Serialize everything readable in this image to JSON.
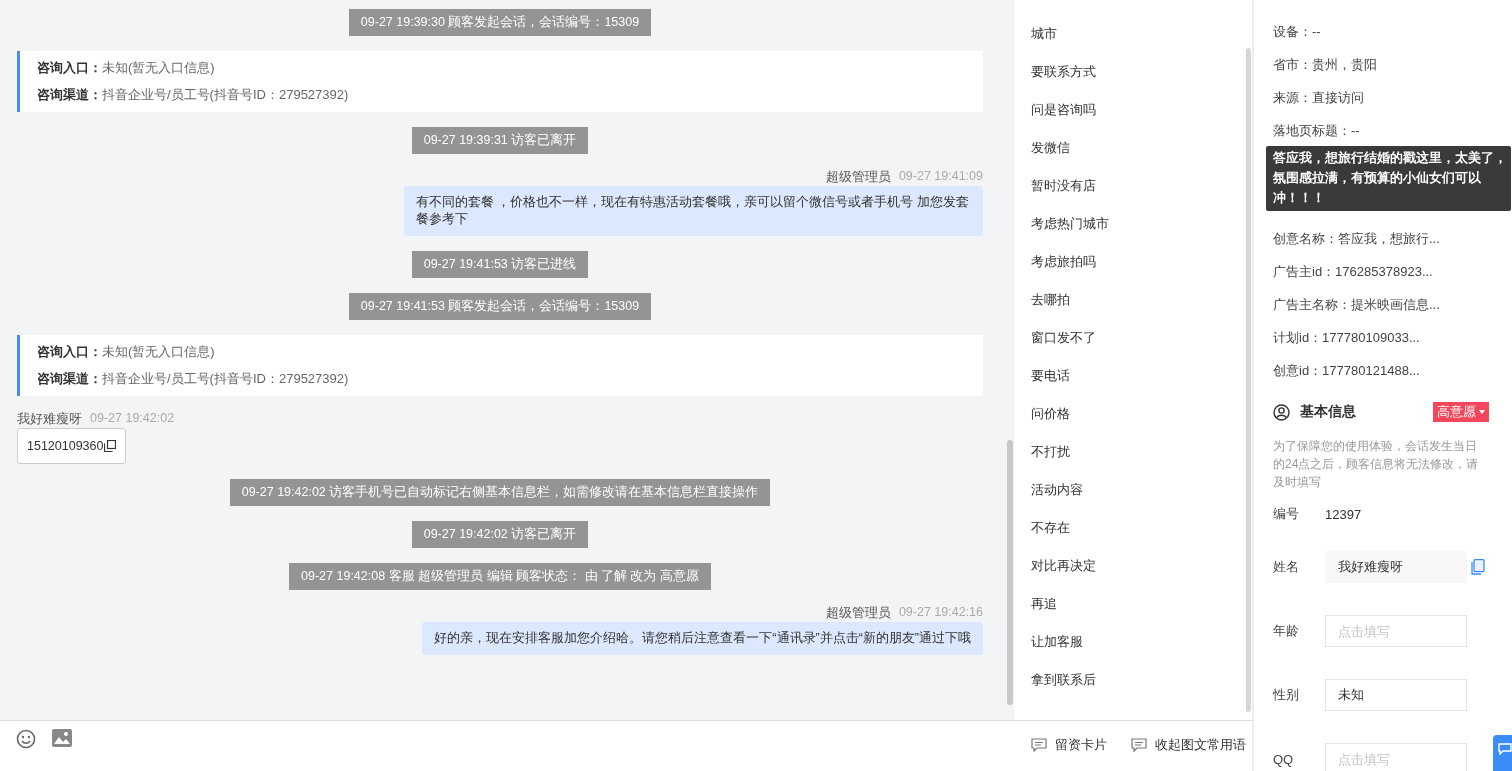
{
  "chat": {
    "messages": [
      {
        "kind": "system",
        "text": "09-27 19:39:30 顾客发起会话，会话编号：15309"
      },
      {
        "kind": "entry",
        "lines": [
          {
            "label": "咨询入口：",
            "value": "未知(暂无入口信息)"
          },
          {
            "label": "咨询渠道：",
            "value": "抖音企业号/员工号(抖音号ID：279527392)"
          }
        ]
      },
      {
        "kind": "system",
        "text": "09-27 19:39:31 访客已离开"
      },
      {
        "kind": "agent",
        "sender": "超级管理员",
        "time": "09-27 19:41:09",
        "text": "有不同的套餐 ，价格也不一样，现在有特惠活动套餐哦，亲可以留个微信号或者手机号 加您发套餐参考下"
      },
      {
        "kind": "system",
        "text": "09-27 19:41:53 访客已进线"
      },
      {
        "kind": "system",
        "text": "09-27 19:41:53 顾客发起会话，会话编号：15309"
      },
      {
        "kind": "entry",
        "lines": [
          {
            "label": "咨询入口：",
            "value": "未知(暂无入口信息)"
          },
          {
            "label": "咨询渠道：",
            "value": "抖音企业号/员工号(抖音号ID：279527392)"
          }
        ]
      },
      {
        "kind": "visitor",
        "sender": "我好难瘦呀",
        "time": "09-27 19:42:02",
        "text": "15120109360"
      },
      {
        "kind": "system",
        "text": "09-27 19:42:02 访客手机号已自动标记右侧基本信息栏，如需修改请在基本信息栏直接操作"
      },
      {
        "kind": "system",
        "text": "09-27 19:42:02 访客已离开"
      },
      {
        "kind": "system",
        "text": "09-27 19:42:08 客服 超级管理员 编辑 顾客状态： 由 了解 改为 高意愿"
      },
      {
        "kind": "agent",
        "sender": "超级管理员",
        "time": "09-27 19:42:16",
        "text": "好的亲，现在安排客服加您介绍哈。请您稍后注意查看一下“通讯录”并点击“新的朋友”通过下哦"
      }
    ]
  },
  "phrases": {
    "items": [
      "城市",
      "要联系方式",
      "问是咨询吗",
      "发微信",
      "暂时没有店",
      "考虑热门城市",
      "考虑旅拍吗",
      "去哪拍",
      "窗口发不了",
      "要电话",
      "问价格",
      "不打扰",
      "活动内容",
      "不存在",
      "对比再决定",
      "再追",
      "让加客服",
      "拿到联系后"
    ],
    "footer": [
      {
        "label": "留资卡片"
      },
      {
        "label": "收起图文常用语"
      }
    ]
  },
  "visitor_info": {
    "rows": [
      "设备：--",
      "省市：贵州，贵阳",
      "来源：直接访问",
      "落地页标题：--"
    ],
    "tooltip": "答应我，想旅行结婚的戳这里，太美了，氛围感拉满，有预算的小仙女们可以冲！！！",
    "rows_after": [
      "创意名称：答应我，想旅行...",
      "广告主id：176285378923...",
      "广告主名称：提米映画信息...",
      "计划id：177780109033...",
      "创意id：177780121488..."
    ]
  },
  "basic_info": {
    "title": "基本信息",
    "status": "高意愿",
    "notice": "为了保障您的使用体验，会话发生当日的24点之后，顾客信息将无法修改，请及时填写",
    "fields": [
      {
        "kind": "plain",
        "label": "编号",
        "value": "12397"
      },
      {
        "kind": "readonly",
        "label": "姓名",
        "value": "我好难瘦呀"
      },
      {
        "kind": "input",
        "label": "年龄",
        "placeholder": "点击填写"
      },
      {
        "kind": "input",
        "label": "性别",
        "value": "未知"
      },
      {
        "kind": "input",
        "label": "QQ",
        "placeholder": "点击填写"
      }
    ]
  }
}
